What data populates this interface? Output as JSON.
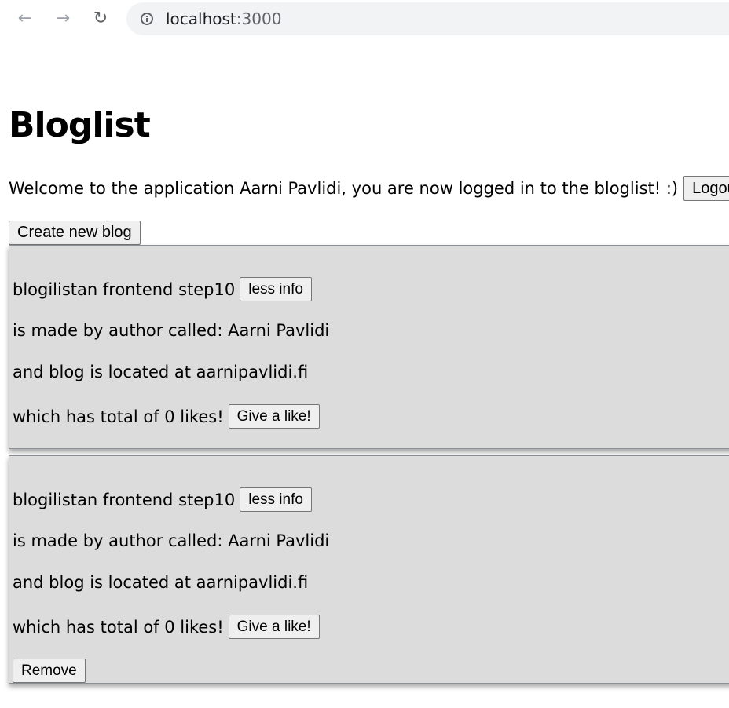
{
  "browser": {
    "url_host": "localhost",
    "url_port": ":3000"
  },
  "page": {
    "title": "Bloglist",
    "welcome": "Welcome to the application Aarni Pavlidi, you are now logged in to the bloglist! :)",
    "logout_label": "Logout",
    "create_label": "Create new blog"
  },
  "blogs": [
    {
      "title": "blogilistan frontend step10",
      "toggle_label": "less info",
      "author_line": "is made by author called: Aarni Pavlidi",
      "url_line": "and blog is located at aarnipavlidi.fi",
      "likes_line": "which has total of 0 likes!",
      "like_label": "Give a like!"
    },
    {
      "title": "blogilistan frontend step10",
      "toggle_label": "less info",
      "author_line": "is made by author called: Aarni Pavlidi",
      "url_line": "and blog is located at aarnipavlidi.fi",
      "likes_line": "which has total of 0 likes!",
      "like_label": "Give a like!",
      "remove_label": "Remove"
    }
  ]
}
